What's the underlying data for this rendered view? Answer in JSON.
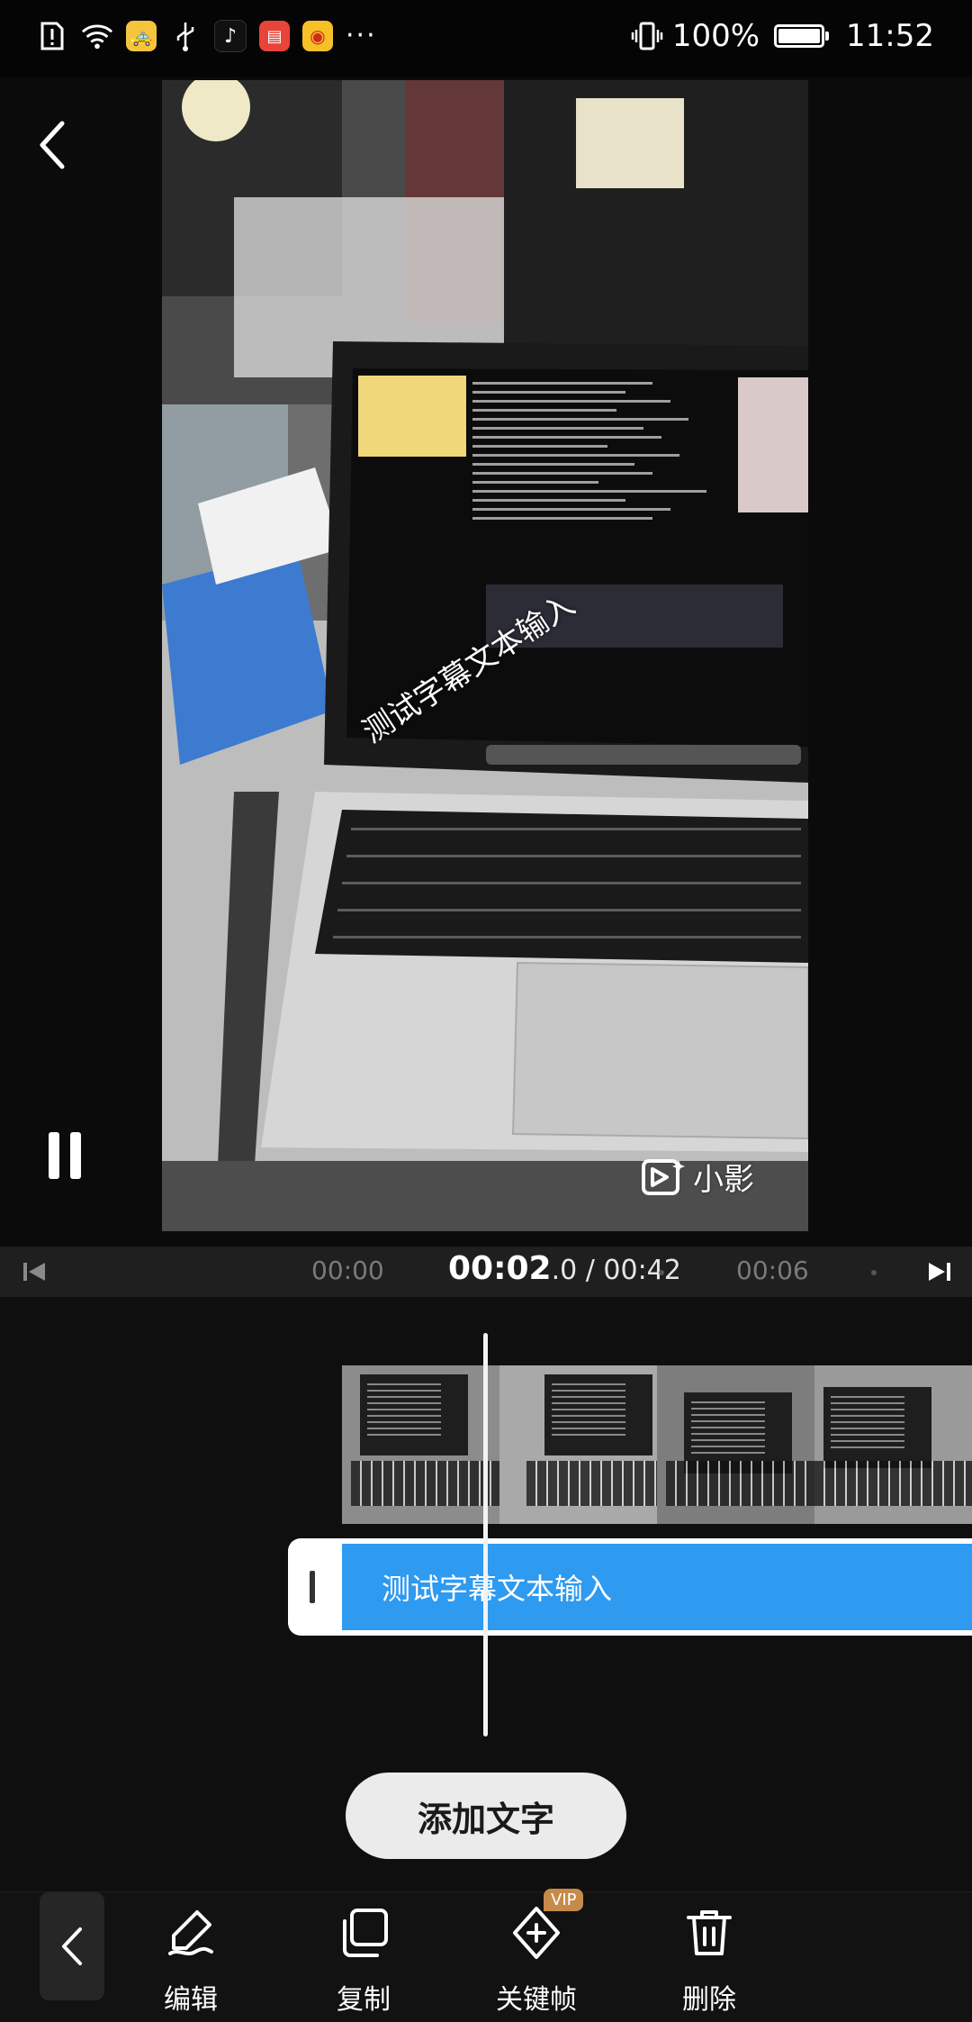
{
  "status_bar": {
    "battery_percent": "100%",
    "battery_level": 1.0,
    "time": "11:52",
    "more": "···"
  },
  "preview": {
    "subtitle_text": "测试字幕文本输入",
    "watermark_text": "小影"
  },
  "timeline": {
    "tick_start": "00:00",
    "current_time": "00:02",
    "current_fraction": ".0",
    "total_time": " / 00:42",
    "tick_next": "00:06"
  },
  "tracks": {
    "text_clip_label": "测试字幕文本输入",
    "add_text_label": "添加文字"
  },
  "toolbar": {
    "edit_label": "编辑",
    "copy_label": "复制",
    "keyframe_label": "关键帧",
    "keyframe_badge": "VIP",
    "delete_label": "删除"
  },
  "colors": {
    "accent_blue": "#2e9af0",
    "vip_gold": "#c68a4a",
    "background": "#0f0f0f"
  }
}
